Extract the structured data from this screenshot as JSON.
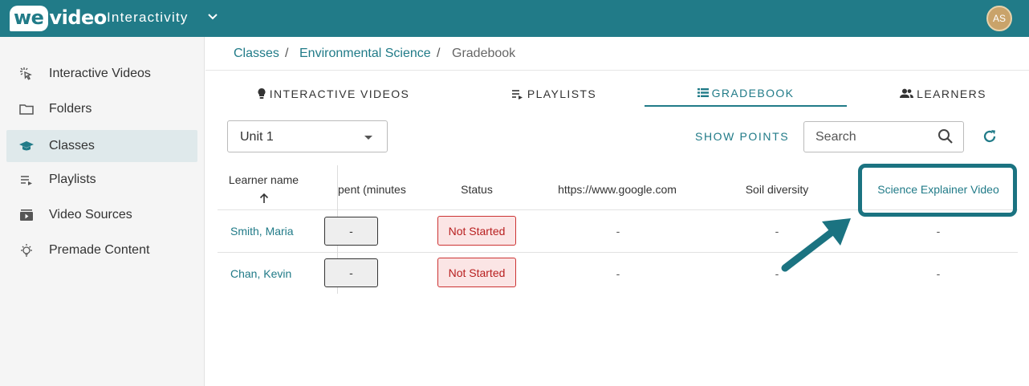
{
  "header": {
    "logo_text": "wevideo",
    "logo_we": "we",
    "logo_rest": "video",
    "app_title": "Interactivity",
    "avatar_initials": "AS"
  },
  "sidebar": {
    "items": [
      {
        "label": "Interactive Videos",
        "icon": "cursor-click-icon"
      },
      {
        "label": "Folders",
        "icon": "folder-icon"
      },
      {
        "label": "Classes",
        "icon": "graduation-cap-icon",
        "active": true
      },
      {
        "label": "Playlists",
        "icon": "playlist-icon"
      },
      {
        "label": "Video Sources",
        "icon": "video-library-icon"
      },
      {
        "label": "Premade Content",
        "icon": "lightbulb-icon"
      }
    ]
  },
  "breadcrumb": {
    "items": [
      "Classes",
      "Environmental Science",
      "Gradebook"
    ],
    "separator": "/"
  },
  "tabs": [
    {
      "label": "INTERACTIVE VIDEOS",
      "icon": "lightbulb-icon"
    },
    {
      "label": "PLAYLISTS",
      "icon": "playlist-icon"
    },
    {
      "label": "GRADEBOOK",
      "icon": "list-icon",
      "active": true
    },
    {
      "label": "LEARNERS",
      "icon": "people-icon"
    }
  ],
  "controls": {
    "unit_value": "Unit 1",
    "show_points_label": "SHOW POINTS",
    "search_placeholder": "Search"
  },
  "table": {
    "headers": {
      "learner_name": "Learner name",
      "time_spent": "pent (minutes)",
      "status": "Status",
      "col_google": "https://www.google.com",
      "col_soil": "Soil diversity",
      "col_science": "Science Explainer Video"
    },
    "rows": [
      {
        "learner": "Smith, Maria",
        "time": "-",
        "status": "Not Started",
        "google": "-",
        "soil": "-",
        "science": "-"
      },
      {
        "learner": "Chan, Kevin",
        "time": "-",
        "status": "Not Started",
        "google": "-",
        "soil": "-",
        "science": "-"
      }
    ]
  },
  "colors": {
    "brand": "#217b88",
    "status_not_started": "#b82020"
  }
}
